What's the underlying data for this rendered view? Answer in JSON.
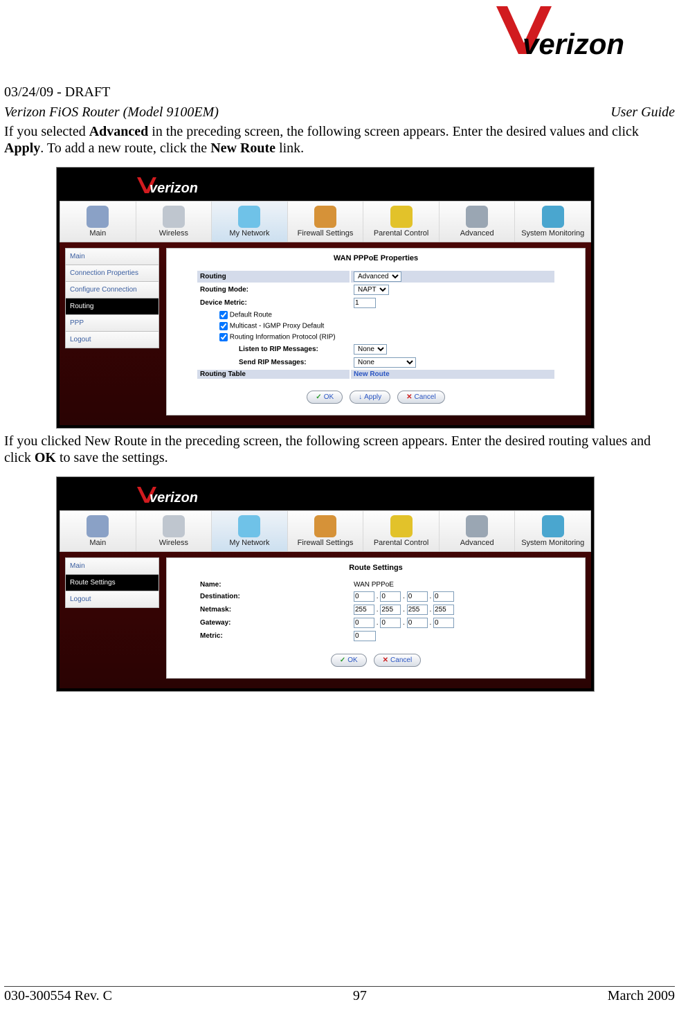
{
  "header": {
    "draft": "03/24/09 - DRAFT",
    "left": "Verizon FiOS Router (Model 9100EM)",
    "right": "User Guide"
  },
  "logo": {
    "brand": "verizon"
  },
  "para1": {
    "t1": "If you selected ",
    "b1": "Advanced",
    "t2": " in the preceding screen, the following screen appears. Enter the desired values and click ",
    "b2": "Apply",
    "t3": ". To add a new route, click the ",
    "b3": "New Route",
    "t4": " link."
  },
  "para2": {
    "t1": "If you clicked New Route in the preceding screen, the following screen appears. Enter the desired routing values and click ",
    "b1": "OK",
    "t2": " to save the settings."
  },
  "nav": [
    "Main",
    "Wireless",
    "My Network",
    "Firewall Settings",
    "Parental Control",
    "Advanced",
    "System Monitoring"
  ],
  "nav_icons": [
    "#8aa1c6",
    "#bfc6cf",
    "#6fc2e8",
    "#d69238",
    "#e2c22a",
    "#9aa6b3",
    "#4aa6cf"
  ],
  "shot1": {
    "title": "WAN PPPoE Properties",
    "sidebar": [
      "Main",
      "Connection Properties",
      "Configure Connection",
      "Routing",
      "PPP",
      "Logout"
    ],
    "sidebar_sel": 3,
    "rows": {
      "routing": "Routing",
      "routing_val": "Advanced",
      "mode": "Routing Mode:",
      "mode_val": "NAPT",
      "metric": "Device Metric:",
      "metric_val": "1",
      "cb1": "Default Route",
      "cb2": "Multicast - IGMP Proxy Default",
      "cb3": "Routing Information Protocol (RIP)",
      "listen": "Listen to RIP Messages:",
      "listen_val": "None",
      "send": "Send RIP Messages:",
      "send_val": "None",
      "table": "Routing Table",
      "newroute": "New Route"
    },
    "buttons": {
      "ok": "OK",
      "apply": "Apply",
      "cancel": "Cancel"
    }
  },
  "shot2": {
    "title": "Route Settings",
    "sidebar": [
      "Main",
      "Route Settings",
      "Logout"
    ],
    "sidebar_sel": 1,
    "rows": {
      "name": "Name:",
      "name_val": "WAN PPPoE",
      "dest": "Destination:",
      "dest_v": [
        "0",
        "0",
        "0",
        "0"
      ],
      "mask": "Netmask:",
      "mask_v": [
        "255",
        "255",
        "255",
        "255"
      ],
      "gw": "Gateway:",
      "gw_v": [
        "0",
        "0",
        "0",
        "0"
      ],
      "metric": "Metric:",
      "metric_v": "0"
    },
    "buttons": {
      "ok": "OK",
      "cancel": "Cancel"
    }
  },
  "footer": {
    "left": "030-300554 Rev. C",
    "center": "97",
    "right": "March 2009"
  }
}
